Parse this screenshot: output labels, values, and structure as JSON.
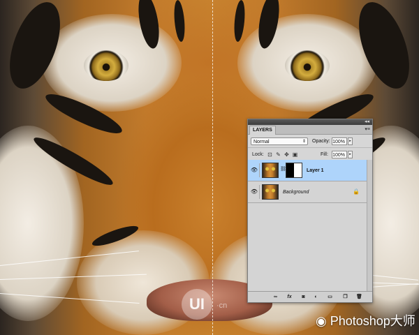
{
  "panel": {
    "tab_label": "LAYERS",
    "blend_mode": "Normal",
    "opacity_label": "Opacity:",
    "opacity_value": "100%",
    "lock_label": "Lock:",
    "fill_label": "Fill:",
    "fill_value": "100%",
    "layers": [
      {
        "name": "Layer 1",
        "selected": true,
        "has_mask": true
      },
      {
        "name": "Background",
        "selected": false,
        "locked": true
      }
    ],
    "footer_icons": [
      "link-icon",
      "fx-icon",
      "mask-icon",
      "adjustment-icon",
      "group-icon",
      "new-layer-icon",
      "trash-icon"
    ]
  },
  "watermarks": {
    "logo": "UI",
    "logo_suffix": "·cn",
    "brand": "Photoshop大师"
  }
}
